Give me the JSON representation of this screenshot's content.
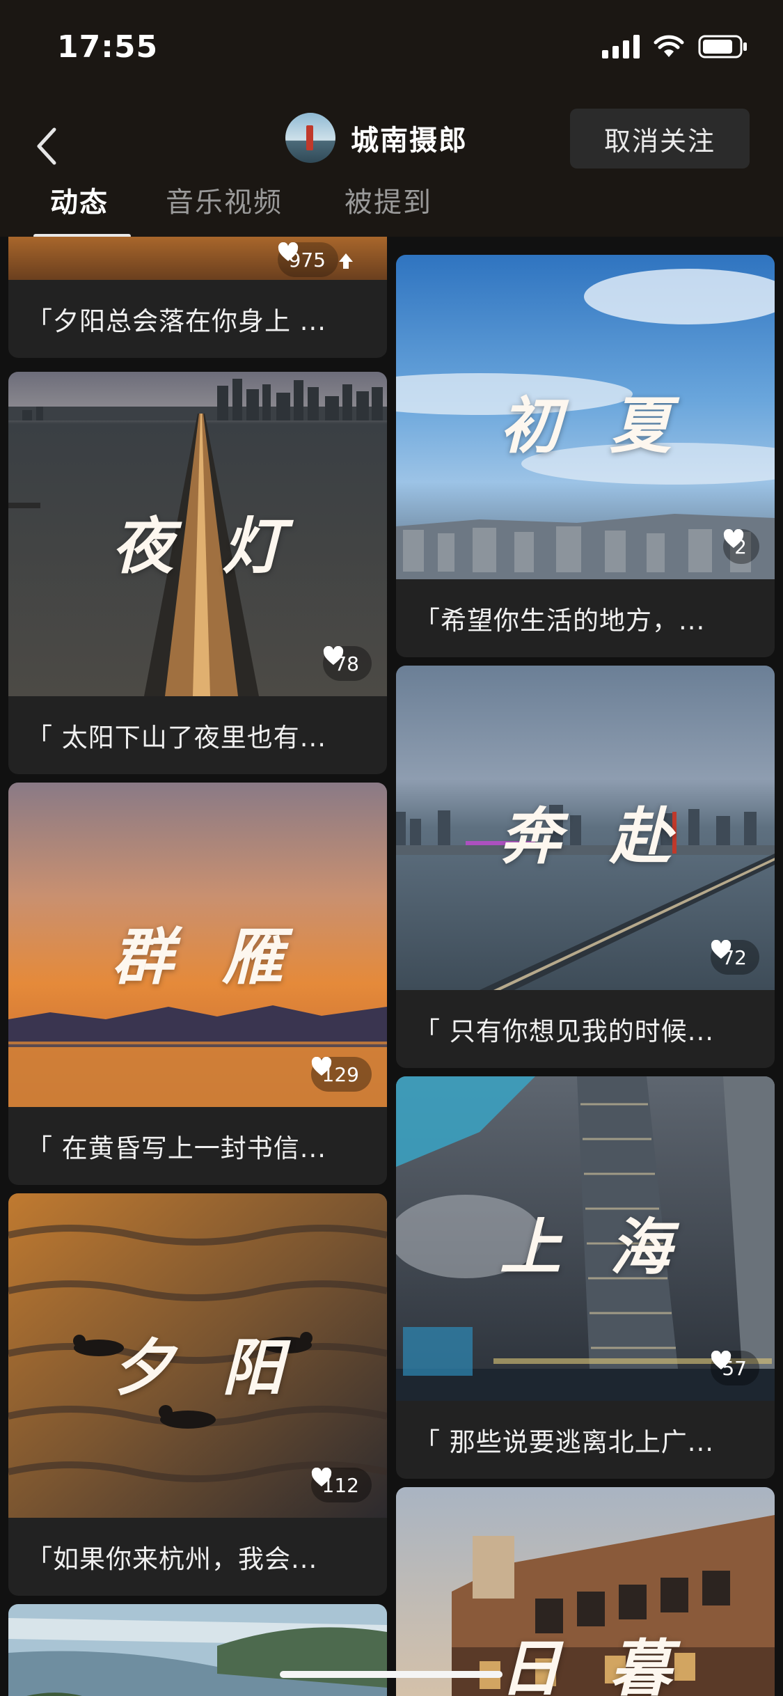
{
  "status_bar": {
    "time": "17:55"
  },
  "header": {
    "profile_name": "城南摄郎",
    "unfollow_label": "取消关注"
  },
  "tabs": [
    {
      "label": "动态",
      "active": true
    },
    {
      "label": "音乐视频",
      "active": false
    },
    {
      "label": "被提到",
      "active": false
    }
  ],
  "feed": {
    "left": [
      {
        "overlay": "",
        "likes": "975",
        "caption": "「夕阳总会落在你身上 ..."
      },
      {
        "overlay": "夜灯",
        "likes": "78",
        "caption": "「 太阳下山了夜里也有..."
      },
      {
        "overlay": "群雁",
        "likes": "129",
        "caption": "「 在黄昏写上一封书信..."
      },
      {
        "overlay": "夕阳",
        "likes": "112",
        "caption": "「如果你来杭州，我会..."
      }
    ],
    "right": [
      {
        "overlay": "初夏",
        "likes": "2",
        "caption": "「希望你生活的地方，..."
      },
      {
        "overlay": "奔赴",
        "likes": "72",
        "caption": "「 只有你想见我的时候..."
      },
      {
        "overlay": "上海",
        "likes": "57",
        "caption": "「 那些说要逃离北上广..."
      },
      {
        "overlay": "日暮",
        "likes": "",
        "caption": ""
      }
    ]
  },
  "icons": {
    "back": "chevron-left-icon",
    "like": "heart-icon",
    "signal": "cellular-signal-icon",
    "wifi": "wifi-icon",
    "battery": "battery-icon"
  }
}
